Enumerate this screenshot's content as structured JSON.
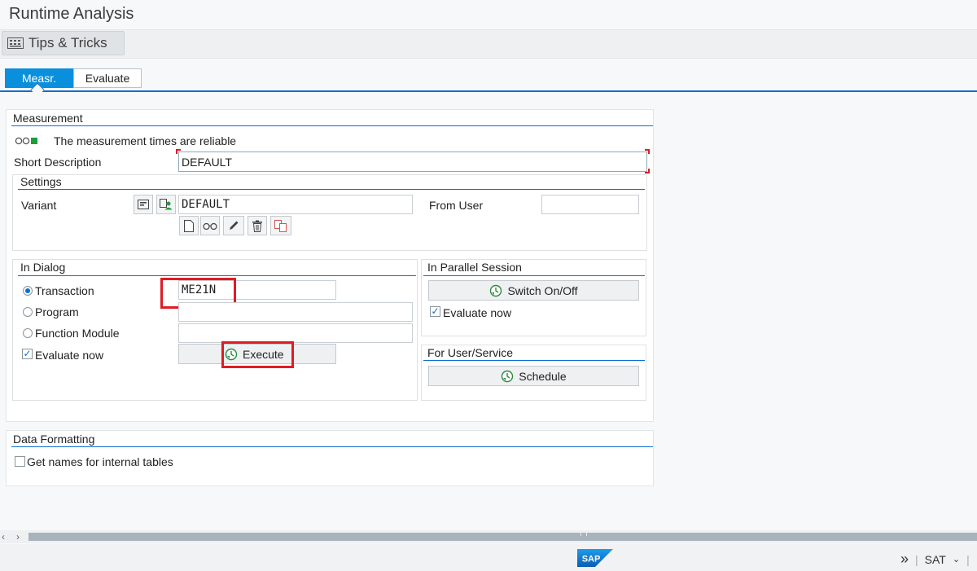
{
  "window": {
    "title": "Runtime Analysis"
  },
  "toolbar": {
    "tips_label": "Tips & Tricks"
  },
  "tabs": [
    {
      "label": "Measr.",
      "active": true
    },
    {
      "label": "Evaluate",
      "active": false
    }
  ],
  "measurement": {
    "title": "Measurement",
    "reliability_text": "The measurement times are reliable",
    "short_desc_label": "Short Description",
    "short_desc_value": "DEFAULT"
  },
  "settings": {
    "title": "Settings",
    "variant_label": "Variant",
    "variant_value": "DEFAULT",
    "from_user_label": "From User",
    "from_user_value": ""
  },
  "in_dialog": {
    "title": "In Dialog",
    "transaction_label": "Transaction",
    "transaction_value": "ME21N",
    "program_label": "Program",
    "program_value": "",
    "function_module_label": "Function Module",
    "function_module_value": "",
    "evaluate_now_label": "Evaluate now",
    "execute_label": "Execute"
  },
  "parallel": {
    "title": "In Parallel Session",
    "switch_label": "Switch On/Off",
    "evaluate_now_label": "Evaluate now"
  },
  "for_user": {
    "title": "For User/Service",
    "schedule_label": "Schedule"
  },
  "data_formatting": {
    "title": "Data Formatting",
    "internal_tables_label": "Get names for internal tables"
  },
  "status": {
    "system": "SAT",
    "logo_text": "SAP"
  },
  "colors": {
    "accent": "#0a6ed1",
    "active_tab": "#0a8fdc",
    "highlight": "#e01b24",
    "traffic_green": "#1f9d3a"
  }
}
